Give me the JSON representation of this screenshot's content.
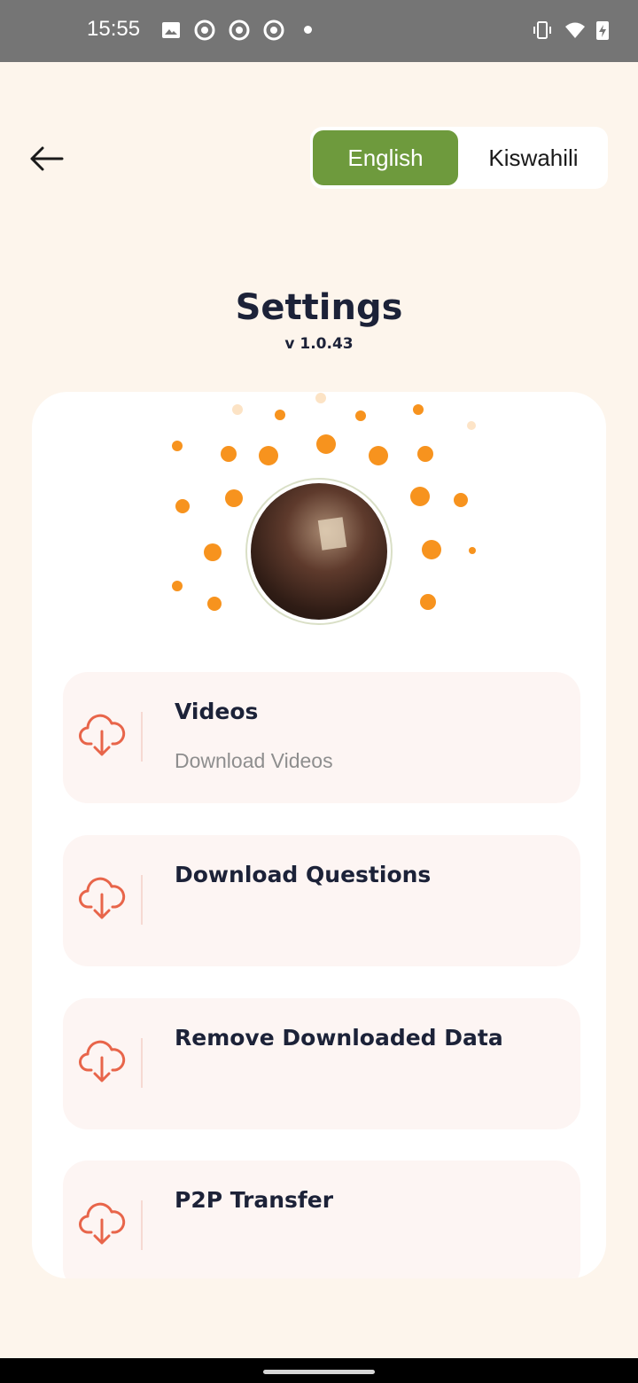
{
  "status_bar": {
    "time": "15:55",
    "left_icons": [
      "image-icon",
      "chrome-icon",
      "chrome-icon",
      "chrome-icon",
      "dot-icon"
    ],
    "right_icons": [
      "vibrate-icon",
      "wifi-icon",
      "battery-charging-icon"
    ]
  },
  "header": {
    "back_icon": "arrow-left-icon",
    "languages": [
      "English",
      "Kiswahili"
    ],
    "selected_language": "English"
  },
  "title": "Settings",
  "version": "v 1.0.43",
  "items": [
    {
      "title": "Videos",
      "subtitle": "Download Videos",
      "icon": "cloud-download-icon"
    },
    {
      "title": "Download Questions",
      "subtitle": "",
      "icon": "cloud-download-icon"
    },
    {
      "title": "Remove Downloaded Data",
      "subtitle": "",
      "icon": "cloud-download-icon"
    },
    {
      "title": "P2P Transfer",
      "subtitle": "",
      "icon": "cloud-download-icon"
    }
  ],
  "colors": {
    "background": "#fdf5ec",
    "accent_green": "#6e9a3d",
    "icon_orange": "#e8654a",
    "dot_orange": "#f7931e",
    "text_dark": "#1c2238"
  }
}
